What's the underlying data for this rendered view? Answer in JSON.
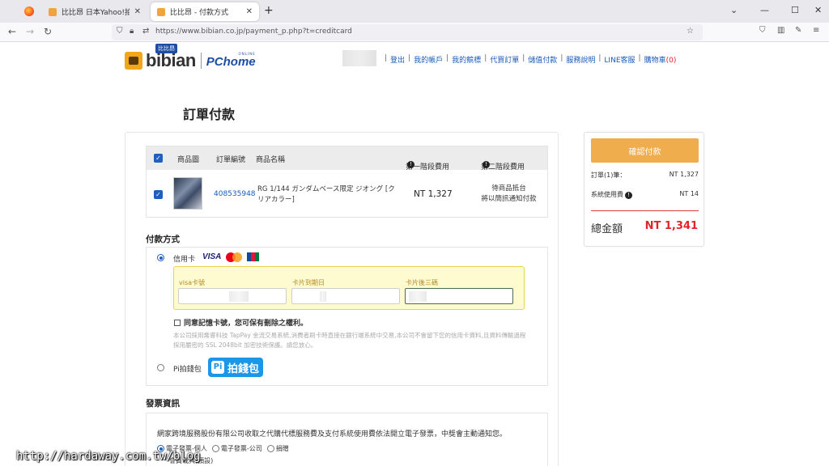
{
  "browser": {
    "tabs": [
      {
        "title": "比比昂 日本Yahoo!拍賣代標 | 比",
        "close": "✕"
      },
      {
        "title": "比比昂 - 付款方式",
        "close": "✕"
      }
    ],
    "new_tab": "+",
    "url": "https://www.bibian.co.jp/payment_p.php?t=creditcard",
    "window_controls": {
      "collapse": "⌄",
      "minimize": "—",
      "maximize": "☐",
      "close": "✕"
    }
  },
  "header": {
    "logo": {
      "brand": "bibian",
      "tag": "比比昂",
      "partner": "PChome",
      "partner_sub": "ONLINE"
    },
    "nav": [
      {
        "label": "登出"
      },
      {
        "label": "我的帳戶"
      },
      {
        "label": "我的競標"
      },
      {
        "label": "代買訂單"
      },
      {
        "label": "儲值付款"
      },
      {
        "label": "服務說明"
      },
      {
        "label": "LINE客服"
      },
      {
        "label": "購物車",
        "count": "(0)"
      }
    ]
  },
  "page": {
    "title": "訂單付款",
    "table": {
      "headers": {
        "image": "商品圖",
        "order_no": "訂單編號",
        "name": "商品名稱",
        "fee1": "第一階段費用",
        "fee2": "第二階段費用"
      },
      "rows": [
        {
          "order_no": "408535948",
          "name": "RG 1/144 ガンダムベース限定 ジオング [クリアカラー]",
          "fee1": "NT 1,327",
          "fee2_line1": "待商品抵台",
          "fee2_line2": "將以簡訊通知付款"
        }
      ]
    },
    "payment": {
      "section_title": "付款方式",
      "credit_label": "信用卡",
      "visa_logo": "VISA",
      "card_number_label": "visa卡號",
      "expiry_label": "卡片到期日",
      "cvv_label": "卡片後三碼",
      "remember_label": "同意記憶卡號，您可保有刪除之權利。",
      "disclaimer": "本公司採用喬睿科技 TapPay 金流交易系統,消費者刷卡時直接在銀行端系統中交易,本公司不會留下您的信用卡資料,且資料傳輸過程採用嚴密的 SSL 2048bit 加密技術保護。請您放心。",
      "pi_label": "Pi拍錢包",
      "pi_logo_mark": "Pi",
      "pi_logo_text": "拍錢包"
    },
    "invoice": {
      "section_title": "發票資訊",
      "text": "網家跨境服務股份有限公司收取之代購代標服務費及支付系統使用費依法開立電子發票，中獎會主動通知您。",
      "options": [
        "電子發票-個人",
        "電子發票-公司",
        "捐贈"
      ],
      "sub_option": "會員載具(預設)"
    }
  },
  "summary": {
    "confirm_label": "確認付款",
    "orders_label": "訂單(1)筆：",
    "orders_value": "NT 1,327",
    "system_fee_label": "系統使用費",
    "system_fee_value": "NT 14",
    "total_label": "總金額",
    "total_value": "NT 1,341"
  },
  "watermark": "http://hardaway.com.tw/blog",
  "colors": {
    "accent_orange": "#f0ad4e",
    "link_blue": "#1a5bb8",
    "total_red": "#e0242a",
    "pi_blue": "#1b96e8"
  }
}
